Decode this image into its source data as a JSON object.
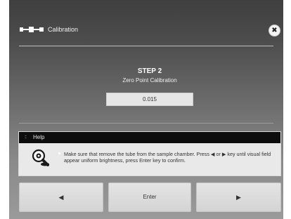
{
  "window": {
    "title": "Calibration",
    "app_icon": "calibration-icon",
    "close_icon": "close-icon",
    "close_glyph": "✖"
  },
  "step": {
    "heading": "STEP 2",
    "subtitle": "Zero Point Calibration",
    "value": "0.015"
  },
  "help": {
    "title": "Help",
    "header_icon": "grip-icon",
    "header_glyph": "::",
    "icon": "zoom-icon",
    "text": "Make sure that remove the tube from the sample chamber. Press ◀ or ▶ key until visual field appear uniform brightness, press Enter key to confirm."
  },
  "buttons": {
    "left_glyph": "◀",
    "enter_label": "Enter",
    "right_glyph": "▶"
  }
}
